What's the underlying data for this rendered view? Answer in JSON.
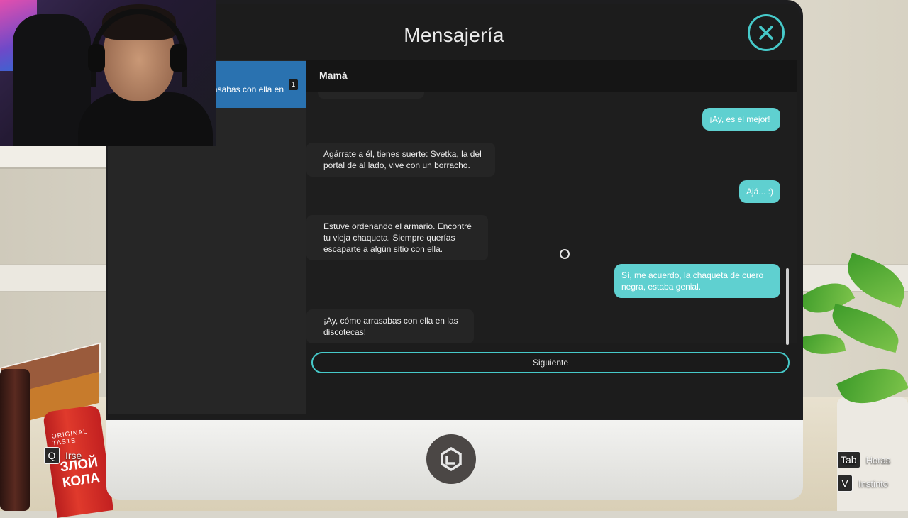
{
  "app": {
    "title": "Mensajería",
    "close_icon": "close-x-icon",
    "accent": "#46c9c9"
  },
  "sidebar": {
    "contacts": [
      {
        "preview": "rrasabas con ella en",
        "badge": "1",
        "highlight": "#2a72b0"
      }
    ]
  },
  "chat": {
    "contact_name": "Mamá",
    "messages": [
      {
        "from": "me",
        "text": "¡Ay, es el mejor!"
      },
      {
        "from": "contact",
        "text": "Agárrate a él, tienes suerte: Svetka, la del portal de al lado, vive con un borracho."
      },
      {
        "from": "me",
        "text": "Ajá... :)"
      },
      {
        "from": "contact",
        "text": "Estuve ordenando el armario. Encontré tu vieja chaqueta. Siempre querías escaparte a algún sitio con ella."
      },
      {
        "from": "me",
        "text": "Sí, me acuerdo, la chaqueta de cuero negra, estaba genial."
      },
      {
        "from": "contact",
        "text": "¡Ay, cómo arrasabas con ella en las discotecas!"
      }
    ],
    "outgoing_color": "#5fd0d0",
    "next_button": "Siguiente"
  },
  "hud": {
    "leave": {
      "key": "Q",
      "label": "Irse"
    },
    "hours": {
      "key": "Tab",
      "label": "Horas"
    },
    "instinct": {
      "key": "V",
      "label": "Instinto"
    }
  },
  "scene": {
    "can_label": "ЗЛОЙ КОЛА",
    "can_top_text": "ORIGINAL TASTE"
  }
}
